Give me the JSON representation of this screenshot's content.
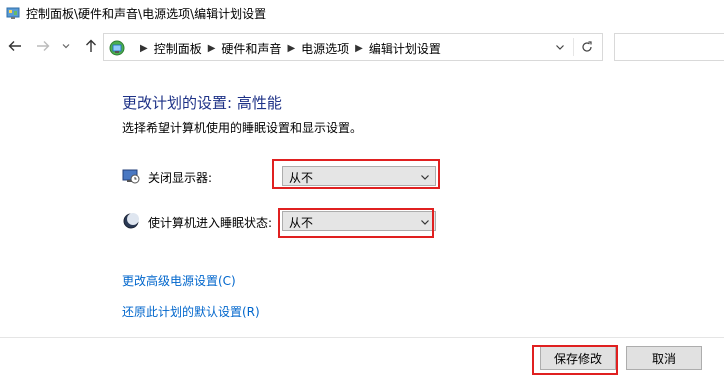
{
  "window": {
    "title": "控制面板\\硬件和声音\\电源选项\\编辑计划设置"
  },
  "address": {
    "crumbs": [
      "控制面板",
      "硬件和声音",
      "电源选项",
      "编辑计划设置"
    ]
  },
  "main": {
    "heading": "更改计划的设置: 高性能",
    "subtext": "选择希望计算机使用的睡眠设置和显示设置。",
    "display_off": {
      "label": "关闭显示器:",
      "value": "从不"
    },
    "sleep": {
      "label": "使计算机进入睡眠状态:",
      "value": "从不"
    },
    "links": {
      "advanced": "更改高级电源设置(C)",
      "restore": "还原此计划的默认设置(R)"
    }
  },
  "buttons": {
    "save": "保存修改",
    "cancel": "取消"
  },
  "colors": {
    "heading": "#1e3287",
    "link": "#0066cc",
    "highlight": "#e02020"
  }
}
